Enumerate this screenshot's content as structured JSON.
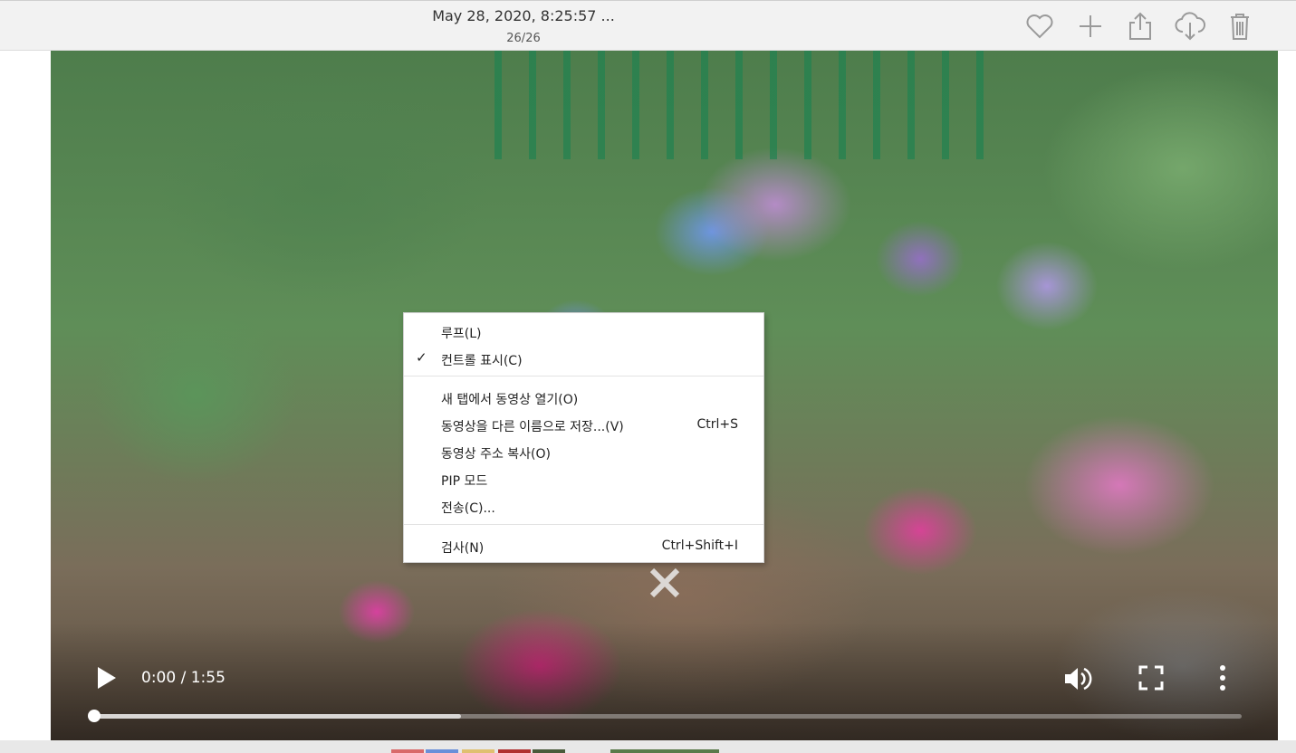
{
  "header": {
    "title": "May 28, 2020, 8:25:57 ...",
    "counter": "26/26",
    "buttons": [
      "heart-icon",
      "plus-icon",
      "share-icon",
      "download-icon",
      "trash-icon"
    ]
  },
  "video": {
    "time": "0:00 / 1:55",
    "progress": 0,
    "buffered": 0.32
  },
  "context_menu": {
    "items": [
      {
        "label": "루프(L)",
        "checked": false,
        "shortcut": ""
      },
      {
        "label": "컨트롤 표시(C)",
        "checked": true,
        "shortcut": ""
      },
      {
        "label": "새 탭에서 동영상 열기(O)",
        "shortcut": ""
      },
      {
        "label": "동영상을 다른 이름으로 저장...(V)",
        "shortcut": "Ctrl+S"
      },
      {
        "label": "동영상 주소 복사(O)",
        "shortcut": ""
      },
      {
        "label": "PIP 모드",
        "shortcut": ""
      },
      {
        "label": "전송(C)...",
        "shortcut": ""
      },
      {
        "label": "검사(N)",
        "shortcut": "Ctrl+Shift+I"
      }
    ],
    "check_mark": "✓"
  },
  "colors": {
    "topbar": "#f2f2f2",
    "icon": "#9a9a9a",
    "menu_bg": "#ffffff"
  }
}
